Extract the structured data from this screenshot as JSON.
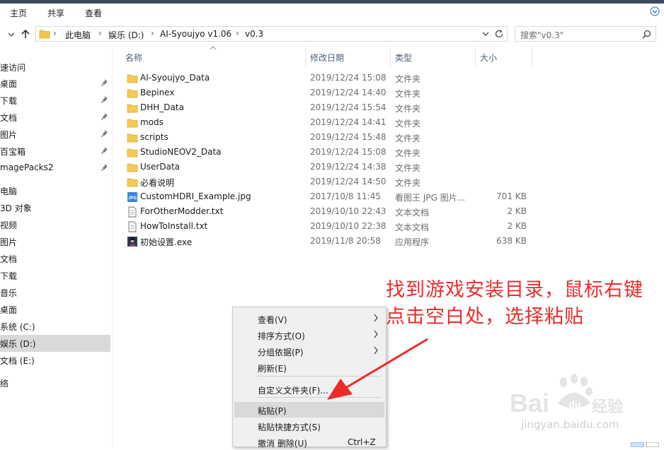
{
  "ribbon": {
    "tabs": [
      "主页",
      "共享",
      "查看"
    ]
  },
  "address": {
    "breadcrumbs": [
      "此电脑",
      "娱乐 (D:)",
      "AI-Syoujyo v1.06",
      "v0.3"
    ],
    "search_placeholder": "搜索\"v0.3\""
  },
  "sidebar": {
    "items": [
      {
        "label": "速访问",
        "pinned": false
      },
      {
        "label": "桌面",
        "pinned": true
      },
      {
        "label": "下载",
        "pinned": true
      },
      {
        "label": "文档",
        "pinned": true
      },
      {
        "label": "图片",
        "pinned": true
      },
      {
        "label": "百宝箱",
        "pinned": true
      },
      {
        "label": "magePacks2",
        "pinned": true
      },
      {
        "label": "电脑",
        "pinned": false
      },
      {
        "label": "3D 对象",
        "pinned": false
      },
      {
        "label": "视频",
        "pinned": false
      },
      {
        "label": "图片",
        "pinned": false
      },
      {
        "label": "文档",
        "pinned": false
      },
      {
        "label": "下载",
        "pinned": false
      },
      {
        "label": "音乐",
        "pinned": false
      },
      {
        "label": "桌面",
        "pinned": false
      },
      {
        "label": "系统 (C:)",
        "pinned": false
      },
      {
        "label": "娱乐 (D:)",
        "pinned": false,
        "selected": true
      },
      {
        "label": "文档 (E:)",
        "pinned": false
      },
      {
        "label": "络",
        "pinned": false
      }
    ]
  },
  "columns": [
    "名称",
    "修改日期",
    "类型",
    "大小"
  ],
  "files": [
    {
      "name": "AI-Syoujyo_Data",
      "date": "2019/12/24 15:08",
      "type": "文件夹",
      "size": "",
      "icon": "folder-icon"
    },
    {
      "name": "Bepinex",
      "date": "2019/12/24 14:40",
      "type": "文件夹",
      "size": "",
      "icon": "folder-icon"
    },
    {
      "name": "DHH_Data",
      "date": "2019/12/24 15:54",
      "type": "文件夹",
      "size": "",
      "icon": "folder-icon"
    },
    {
      "name": "mods",
      "date": "2019/12/24 14:41",
      "type": "文件夹",
      "size": "",
      "icon": "folder-icon"
    },
    {
      "name": "scripts",
      "date": "2019/12/24 15:48",
      "type": "文件夹",
      "size": "",
      "icon": "folder-icon"
    },
    {
      "name": "StudioNEOV2_Data",
      "date": "2019/12/24 15:08",
      "type": "文件夹",
      "size": "",
      "icon": "folder-icon"
    },
    {
      "name": "UserData",
      "date": "2019/12/24 14:38",
      "type": "文件夹",
      "size": "",
      "icon": "folder-icon"
    },
    {
      "name": "必看说明",
      "date": "2019/12/24 14:50",
      "type": "文件夹",
      "size": "",
      "icon": "folder-icon"
    },
    {
      "name": "CustomHDRI_Example.jpg",
      "date": "2017/10/8 11:45",
      "type": "看图王 JPG 图片...",
      "size": "701 KB",
      "icon": "jpg-file-icon"
    },
    {
      "name": "ForOtherModder.txt",
      "date": "2019/10/10 22:43",
      "type": "文本文档",
      "size": "2 KB",
      "icon": "text-file-icon"
    },
    {
      "name": "HowToInstall.txt",
      "date": "2019/10/10 22:38",
      "type": "文本文档",
      "size": "2 KB",
      "icon": "text-file-icon"
    },
    {
      "name": "初始设置.exe",
      "date": "2019/11/8 20:58",
      "type": "应用程序",
      "size": "638 KB",
      "icon": "exe-file-icon"
    }
  ],
  "annotation": {
    "line1": "找到游戏安装目录，鼠标右键",
    "line2": "点击空白处，选择粘贴",
    "color": "#ee2a2a"
  },
  "context_menu": {
    "items": [
      {
        "label": "查看(V)",
        "submenu": true
      },
      {
        "label": "排序方式(O)",
        "submenu": true
      },
      {
        "label": "分组依据(P)",
        "submenu": true
      },
      {
        "label": "刷新(E)",
        "submenu": false
      },
      {
        "label": "自定义文件夹(F)...",
        "submenu": false
      },
      {
        "label": "粘贴(P)",
        "submenu": false,
        "highlighted": true
      },
      {
        "label": "粘贴快捷方式(S)",
        "submenu": false
      },
      {
        "label": "撤消 删除(U)",
        "submenu": false,
        "shortcut": "Ctrl+Z"
      }
    ]
  },
  "watermark": {
    "url": "jingyan.baidu.com",
    "brand": "Bai",
    "brand2": "du",
    "brand3": "经验"
  }
}
